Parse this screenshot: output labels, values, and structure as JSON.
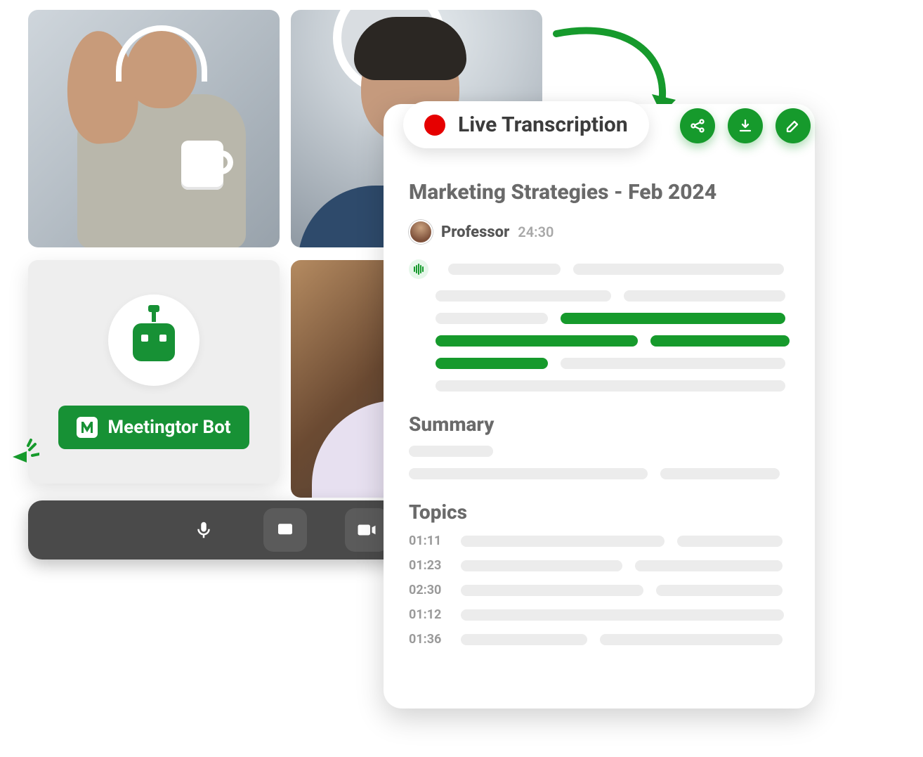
{
  "video": {
    "participants": [
      "Participant 1",
      "Participant 2",
      "Participant 3"
    ]
  },
  "bot": {
    "button_label": "Meetingtor Bot",
    "icon_name": "robot-icon",
    "badge_letter": "M"
  },
  "controls": {
    "mic": "microphone",
    "screen": "present-screen",
    "camera": "video-camera"
  },
  "panel": {
    "live_label": "Live Transcription",
    "action_icons": [
      "share-icon",
      "download-icon",
      "edit-icon"
    ],
    "title": "Marketing Strategies - Feb 2024",
    "speaker": {
      "name": "Professor",
      "time": "24:30"
    },
    "summary_label": "Summary",
    "topics_label": "Topics",
    "topics": [
      {
        "time": "01:11"
      },
      {
        "time": "01:23"
      },
      {
        "time": "02:30"
      },
      {
        "time": "01:12"
      },
      {
        "time": "01:36"
      }
    ]
  },
  "colors": {
    "brand_green": "#169a2c",
    "brand_green_dark": "#179135",
    "red_dot": "#e60000"
  }
}
